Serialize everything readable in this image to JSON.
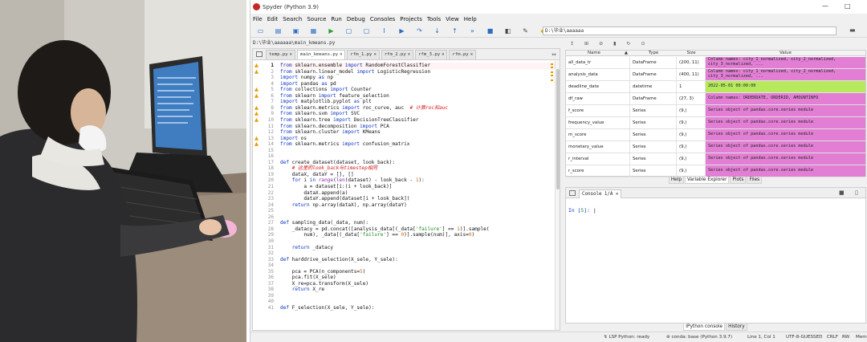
{
  "window": {
    "title": "Spyder (Python 3.9)",
    "minimize": "—",
    "restore": "□"
  },
  "menu": [
    "File",
    "Edit",
    "Search",
    "Source",
    "Run",
    "Debug",
    "Consoles",
    "Projects",
    "Tools",
    "View",
    "Help"
  ],
  "toolbar": {
    "path": "D:\\毕业\\aaaaaa",
    "icons": [
      "new-file-icon",
      "open-file-icon",
      "save-icon",
      "save-all-icon",
      "run-icon",
      "run-cell-icon",
      "run-cell-advance-icon",
      "run-selection-icon",
      "debug-icon",
      "step-icon",
      "step-into-icon",
      "step-return-icon",
      "continue-icon",
      "stop-icon",
      "maximize-pane-icon",
      "preferences-icon",
      "python-path-icon"
    ]
  },
  "editor": {
    "file_path": "D:\\毕业\\aaaaaa\\main_kmeans.py",
    "tabs": [
      {
        "label": "temp.py",
        "active": false
      },
      {
        "label": "main_kmeans.py",
        "active": true
      },
      {
        "label": "rfm_1.py",
        "active": false
      },
      {
        "label": "rfm_2.py",
        "active": false
      },
      {
        "label": "rfm_3.py",
        "active": false
      },
      {
        "label": "rfm.py",
        "active": false
      }
    ],
    "lines": [
      {
        "n": "1",
        "warn": true,
        "text": "from sklearn.ensemble import RandomForestClassifier"
      },
      {
        "n": "2",
        "warn": true,
        "text": "from sklearn.linear_model import LogisticRegression"
      },
      {
        "n": "3",
        "warn": false,
        "text": "import numpy as np"
      },
      {
        "n": "4",
        "warn": false,
        "text": "import pandas as pd"
      },
      {
        "n": "5",
        "warn": true,
        "text": "from collections import Counter"
      },
      {
        "n": "6",
        "warn": true,
        "text": "from sklearn import feature_selection"
      },
      {
        "n": "7",
        "warn": false,
        "text": "import matplotlib.pyplot as plt"
      },
      {
        "n": "8",
        "warn": true,
        "text": "from sklearn.metrics import roc_curve, auc  # 计算roc和auc"
      },
      {
        "n": "9",
        "warn": true,
        "text": "from sklearn.svm import SVC"
      },
      {
        "n": "10",
        "warn": true,
        "text": "from sklearn.tree import DecisionTreeClassifier"
      },
      {
        "n": "11",
        "warn": false,
        "text": "from sklearn.decomposition import PCA"
      },
      {
        "n": "12",
        "warn": false,
        "text": "from sklearn.cluster import KMeans"
      },
      {
        "n": "13",
        "warn": true,
        "text": "import os"
      },
      {
        "n": "14",
        "warn": true,
        "text": "from sklearn.metrics import confusion_matrix"
      },
      {
        "n": "15",
        "warn": false,
        "text": ""
      },
      {
        "n": "16",
        "warn": false,
        "text": ""
      },
      {
        "n": "17",
        "warn": false,
        "text": "def create_dataset(dataset, look_back):"
      },
      {
        "n": "18",
        "warn": false,
        "text": "    # 这里的look_back与timestep相同"
      },
      {
        "n": "19",
        "warn": false,
        "text": "    dataX, dataY = [], []"
      },
      {
        "n": "20",
        "warn": false,
        "text": "    for i in range(len(dataset) - look_back - 1):"
      },
      {
        "n": "21",
        "warn": false,
        "text": "        a = dataset[i:(i + look_back)]"
      },
      {
        "n": "22",
        "warn": false,
        "text": "        dataX.append(a)"
      },
      {
        "n": "23",
        "warn": false,
        "text": "        dataY.append(dataset[i + look_back])"
      },
      {
        "n": "24",
        "warn": false,
        "text": "    return np.array(dataX), np.array(dataY)"
      },
      {
        "n": "25",
        "warn": false,
        "text": ""
      },
      {
        "n": "26",
        "warn": false,
        "text": ""
      },
      {
        "n": "27",
        "warn": false,
        "text": "def sampling_data(_data, num):"
      },
      {
        "n": "28",
        "warn": false,
        "text": "    _datacy = pd.concat([analysis_data[(_data['failure'] == 1)].sample("
      },
      {
        "n": "29",
        "warn": false,
        "text": "        num), _data[(_data['failure'] == 0)].sample(num)], axis=0)"
      },
      {
        "n": "30",
        "warn": false,
        "text": ""
      },
      {
        "n": "31",
        "warn": false,
        "text": "    return _datacy"
      },
      {
        "n": "32",
        "warn": false,
        "text": ""
      },
      {
        "n": "33",
        "warn": false,
        "text": "def harddrive_selection(X_sele, Y_sele):"
      },
      {
        "n": "34",
        "warn": false,
        "text": ""
      },
      {
        "n": "35",
        "warn": false,
        "text": "    pca = PCA(n_components=5)"
      },
      {
        "n": "36",
        "warn": false,
        "text": "    pca.fit(X_sele)"
      },
      {
        "n": "37",
        "warn": false,
        "text": "    X_re=pca.transform(X_sele)"
      },
      {
        "n": "38",
        "warn": false,
        "text": "    return X_re"
      },
      {
        "n": "39",
        "warn": false,
        "text": ""
      },
      {
        "n": "40",
        "warn": false,
        "text": ""
      },
      {
        "n": "41",
        "warn": false,
        "text": "def F_selection(X_sele, Y_sele):"
      }
    ]
  },
  "variable_explorer": {
    "toolbar": [
      "↥",
      "⊞",
      "⊘",
      "▮",
      "↻",
      "⊙"
    ],
    "headers": [
      "Name",
      "▲",
      "Type",
      "Size",
      "Value"
    ],
    "rows": [
      {
        "name": "all_data_tr",
        "type": "DataFrame",
        "size": "(200, 11)",
        "value": "Column names: city_1_normalized, city_2_normalized, city_3_normalized, ...",
        "color": "#e27fd4"
      },
      {
        "name": "analysis_data",
        "type": "DataFrame",
        "size": "(400, 11)",
        "value": "Column names: city_1_normalized, city_2_normalized, city_3_normalized, ...",
        "color": "#e27fd4"
      },
      {
        "name": "deadline_date",
        "type": "datetime",
        "size": "1",
        "value": "2022-05-01 00:00:00",
        "color": "#b6ea5c"
      },
      {
        "name": "df_raw",
        "type": "DataFrame",
        "size": "(27, 3)",
        "value": "Column names: ORDERDATE, ORDERID, AMOUNTINFO",
        "color": "#e27fd4"
      },
      {
        "name": "f_score",
        "type": "Series",
        "size": "(9,)",
        "value": "Series object of pandas.core.series module",
        "color": "#e27fd4"
      },
      {
        "name": "frequency_value",
        "type": "Series",
        "size": "(9,)",
        "value": "Series object of pandas.core.series module",
        "color": "#e27fd4"
      },
      {
        "name": "m_score",
        "type": "Series",
        "size": "(9,)",
        "value": "Series object of pandas.core.series module",
        "color": "#e27fd4"
      },
      {
        "name": "monetary_value",
        "type": "Series",
        "size": "(9,)",
        "value": "Series object of pandas.core.series module",
        "color": "#e27fd4"
      },
      {
        "name": "r_interval",
        "type": "Series",
        "size": "(9,)",
        "value": "Series object of pandas.core.series module",
        "color": "#e27fd4"
      },
      {
        "name": "r_score",
        "type": "Series",
        "size": "(9,)",
        "value": "Series object of pandas.core.series module",
        "color": "#e27fd4"
      }
    ],
    "tabs": [
      {
        "label": "Help",
        "active": false
      },
      {
        "label": "Variable Explorer",
        "active": true
      },
      {
        "label": "Plots",
        "active": false
      },
      {
        "label": "Files",
        "active": false
      }
    ]
  },
  "console": {
    "tab_label": "Console 1/A",
    "prompt_prefix": "In [",
    "prompt_number": "5",
    "prompt_suffix": "]:",
    "tabs": [
      {
        "label": "IPython console",
        "active": true
      },
      {
        "label": "History",
        "active": false
      }
    ]
  },
  "statusbar": {
    "lsp": "LSP Python: ready",
    "conda": "conda: base (Python 3.9.7)",
    "cursor": "Line 1, Col 1",
    "encoding": "UTF-8-GUESSED",
    "eol": "CRLF",
    "mode": "RW",
    "mem": "Mem"
  }
}
